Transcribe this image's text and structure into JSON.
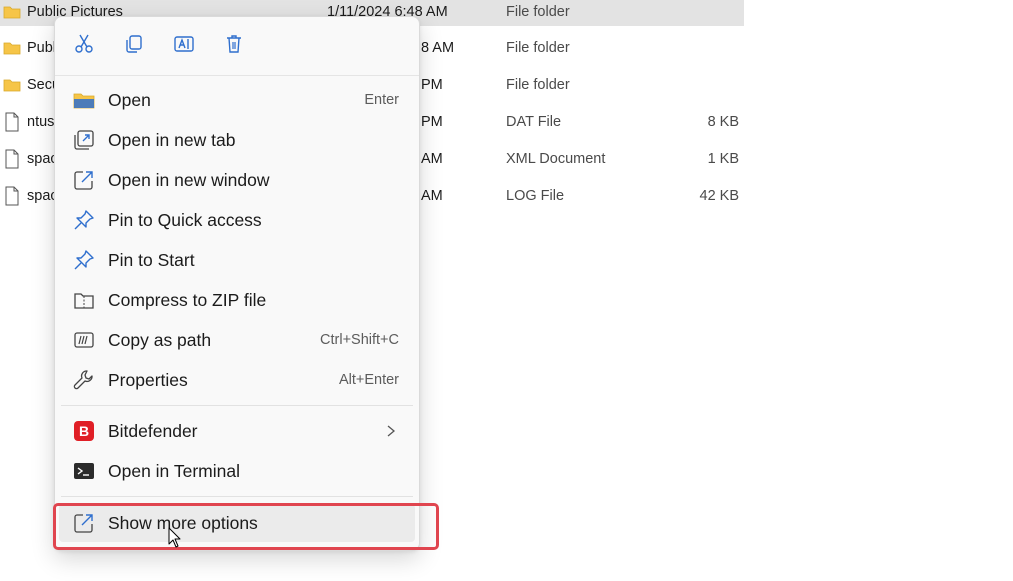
{
  "files": [
    {
      "name": "Public Pictures",
      "date": "1/11/2024 6:48 AM",
      "type": "File folder",
      "size": "",
      "icon": "folder-icon",
      "selected": true
    },
    {
      "name": "Publ",
      "date": "8 AM",
      "type": "File folder",
      "size": "",
      "icon": "folder-icon"
    },
    {
      "name": "Secu",
      "date": "PM",
      "type": "File folder",
      "size": "",
      "icon": "folder-icon"
    },
    {
      "name": "ntus",
      "date": "PM",
      "type": "DAT File",
      "size": "8 KB",
      "icon": "file-icon"
    },
    {
      "name": "spac",
      "date": "AM",
      "type": "XML Document",
      "size": "1 KB",
      "icon": "file-icon"
    },
    {
      "name": "spac",
      "date": "AM",
      "type": "LOG File",
      "size": "42 KB",
      "icon": "file-icon"
    }
  ],
  "context_menu": {
    "quick_actions": [
      {
        "icon": "cut-icon"
      },
      {
        "icon": "copy-icon"
      },
      {
        "icon": "rename-icon"
      },
      {
        "icon": "delete-icon"
      }
    ],
    "items": [
      {
        "label": "Open",
        "shortcut": "Enter",
        "icon": "folder-open-icon"
      },
      {
        "label": "Open in new tab",
        "shortcut": "",
        "icon": "new-tab-icon"
      },
      {
        "label": "Open in new window",
        "shortcut": "",
        "icon": "new-window-icon"
      },
      {
        "label": "Pin to Quick access",
        "shortcut": "",
        "icon": "pin-icon"
      },
      {
        "label": "Pin to Start",
        "shortcut": "",
        "icon": "pin-start-icon"
      },
      {
        "label": "Compress to ZIP file",
        "shortcut": "",
        "icon": "zip-icon"
      },
      {
        "label": "Copy as path",
        "shortcut": "Ctrl+Shift+C",
        "icon": "copy-path-icon"
      },
      {
        "label": "Properties",
        "shortcut": "Alt+Enter",
        "icon": "wrench-icon"
      },
      {
        "label": "Bitdefender",
        "shortcut": "",
        "icon": "bitdefender-icon",
        "submenu": true
      },
      {
        "label": "Open in Terminal",
        "shortcut": "",
        "icon": "terminal-icon"
      },
      {
        "label": "Show more options",
        "shortcut": "",
        "icon": "show-more-icon",
        "highlighted": true
      }
    ]
  },
  "colors": {
    "accent_blue": "#2f6fce",
    "highlight_red": "#e0454f",
    "bitdefender_red": "#e01f26",
    "folder_yellow": "#f6c548"
  }
}
